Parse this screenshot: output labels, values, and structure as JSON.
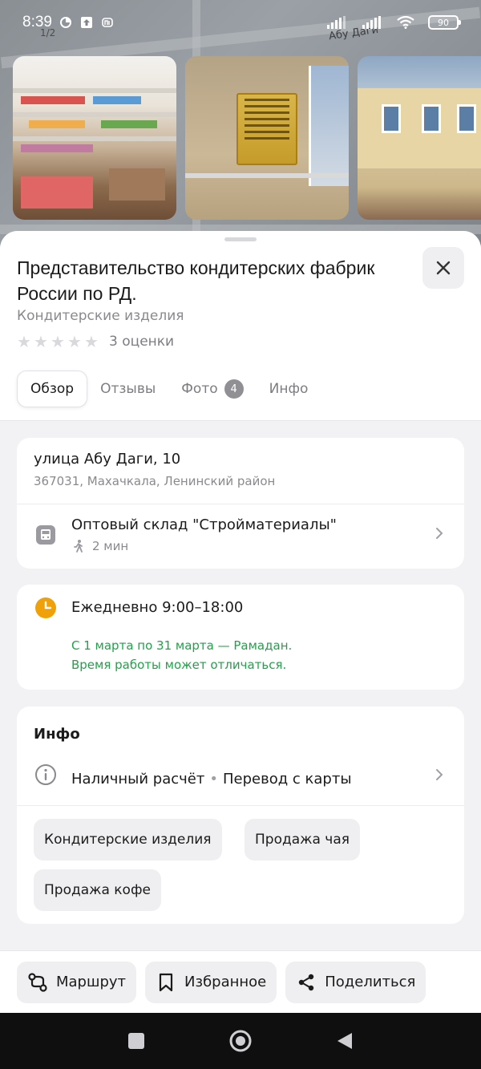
{
  "status_bar": {
    "time": "8:39",
    "battery": "90"
  },
  "map": {
    "street_label": "Абу Даги",
    "number_label": "1/2"
  },
  "place": {
    "title": "Представительство кондитерских фабрик России по РД.",
    "category": "Кондитерские изделия",
    "rating_text": "3 оценки",
    "stars_filled": 0
  },
  "tabs": [
    {
      "label": "Обзор",
      "active": true
    },
    {
      "label": "Отзывы"
    },
    {
      "label": "Фото",
      "badge": "4"
    },
    {
      "label": "Инфо"
    }
  ],
  "address": {
    "street": "улица Абу Даги, 10",
    "details": "367031, Махачкала, Ленинский район"
  },
  "transit": {
    "stop_name": "Оптовый склад \"Стройматериалы\"",
    "walk_time": "2 мин"
  },
  "hours": {
    "main": "Ежедневно 9:00–18:00",
    "note_line1": "С 1 марта по 31 марта — Рамадан.",
    "note_line2": "Время работы может отличаться."
  },
  "info": {
    "title": "Инфо",
    "payment1": "Наличный расчёт",
    "separator": "•",
    "payment2": "Перевод с карты",
    "chips": [
      "Кондитерские изделия",
      "Продажа чая",
      "Продажа кофе"
    ]
  },
  "actions": {
    "route": "Маршрут",
    "favorite": "Избранное",
    "share": "Поделиться"
  },
  "colors": {
    "green_note": "#23a14a",
    "clock": "#f0a10a"
  }
}
